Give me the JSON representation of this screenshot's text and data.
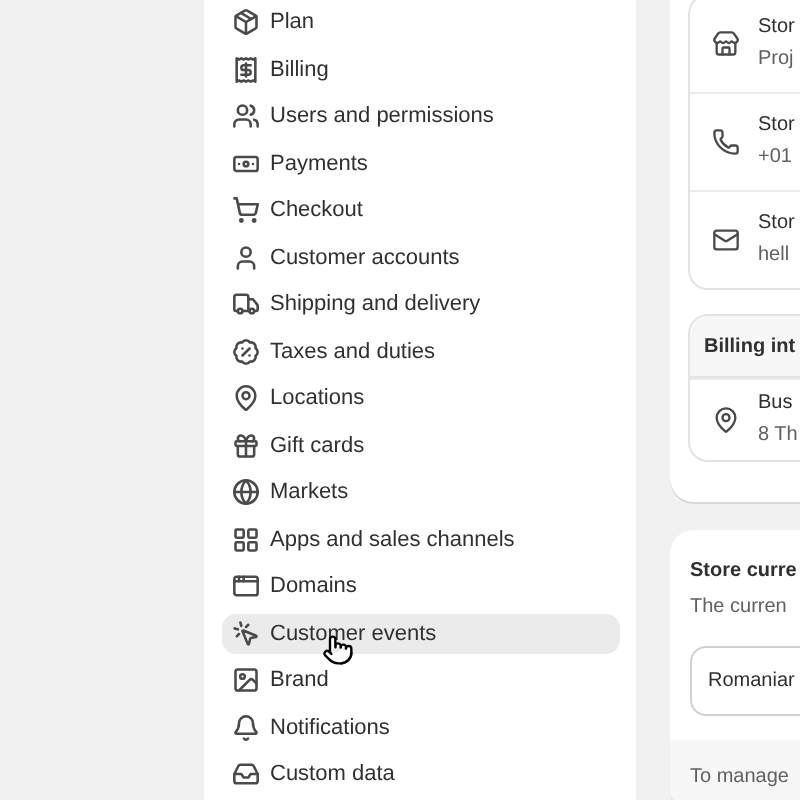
{
  "sidebar": {
    "items": [
      {
        "label": "Plan",
        "selected": false
      },
      {
        "label": "Billing",
        "selected": false
      },
      {
        "label": "Users and permissions",
        "selected": false
      },
      {
        "label": "Payments",
        "selected": false
      },
      {
        "label": "Checkout",
        "selected": false
      },
      {
        "label": "Customer accounts",
        "selected": false
      },
      {
        "label": "Shipping and delivery",
        "selected": false
      },
      {
        "label": "Taxes and duties",
        "selected": false
      },
      {
        "label": "Locations",
        "selected": false
      },
      {
        "label": "Gift cards",
        "selected": false
      },
      {
        "label": "Markets",
        "selected": false
      },
      {
        "label": "Apps and sales channels",
        "selected": false
      },
      {
        "label": "Domains",
        "selected": false
      },
      {
        "label": "Customer events",
        "selected": true
      },
      {
        "label": "Brand",
        "selected": false
      },
      {
        "label": "Notifications",
        "selected": false
      },
      {
        "label": "Custom data",
        "selected": false
      }
    ]
  },
  "store_details": {
    "rows": [
      {
        "title": "Stor",
        "value": "Proj"
      },
      {
        "title": "Stor",
        "value": "+01"
      },
      {
        "title": "Stor",
        "value": "hell"
      }
    ],
    "billing": {
      "title": "Billing int",
      "rows": [
        {
          "title": "Bus",
          "value": "8 Th"
        }
      ]
    }
  },
  "currency": {
    "title": "Store curre",
    "description": "The curren",
    "select": {
      "value": "Romaniar"
    },
    "footer": "To manage"
  }
}
